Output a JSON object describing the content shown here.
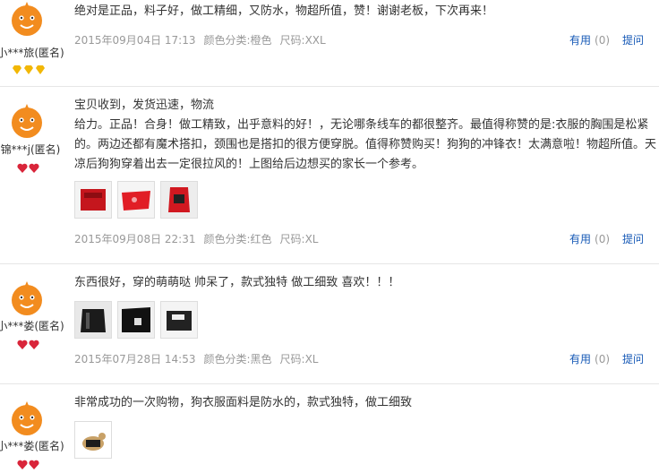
{
  "reviews": [
    {
      "user": "小***旅(匿名)",
      "content": "绝对是正品，料子好，做工精细，又防水，物超所值，赞！谢谢老板，下次再来！",
      "date": "2015年09月04日 17:13",
      "color": "颜色分类:橙色",
      "size": "尺码:XXL",
      "useful_label": "有用",
      "useful_count": "(0)",
      "ask_label": "提问",
      "badge": "diamond-yellow"
    },
    {
      "user": "锦***j(匿名)",
      "content": "宝贝收到，发货迅速，物流\n给力。正品！合身！做工精致，出乎意料的好！，无论哪条线车的都很整齐。最值得称赞的是:衣服的胸围是松紧的。两边还都有魔术搭扣，颈围也是搭扣的很方便穿脱。值得称赞购买！狗狗的冲锋衣！太满意啦！物超所值。天凉后狗狗穿着出去一定很拉风的！上图给后边想买的家长一个参考。",
      "date": "2015年09月08日 22:31",
      "color": "颜色分类:红色",
      "size": "尺码:XL",
      "useful_label": "有用",
      "useful_count": "(0)",
      "ask_label": "提问",
      "badge": "heart-red"
    },
    {
      "user": "小***娄(匿名)",
      "content": "东西很好，穿的萌萌哒 帅呆了，款式独特 做工细致 喜欢！！！",
      "date": "2015年07月28日 14:53",
      "color": "颜色分类:黑色",
      "size": "尺码:XL",
      "useful_label": "有用",
      "useful_count": "(0)",
      "ask_label": "提问",
      "badge": "heart-red"
    },
    {
      "user": "小***娄(匿名)",
      "content": "非常成功的一次购物，狗衣服面料是防水的，款式独特，做工细致",
      "badge": "heart-red"
    }
  ],
  "colors": {
    "link": "#1659b6",
    "meta": "#999999",
    "avatar": "#f28c1f",
    "diamond": "#f2b705",
    "heart": "#d9253a"
  }
}
